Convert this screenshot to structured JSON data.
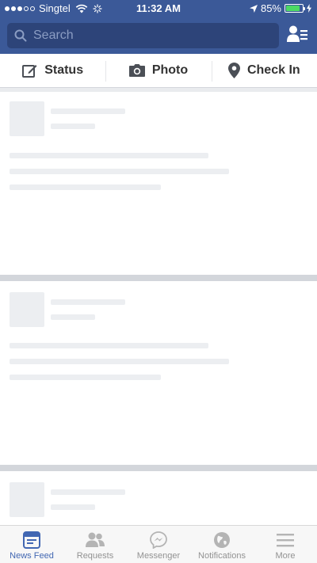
{
  "status_bar": {
    "carrier": "Singtel",
    "time": "11:32 AM",
    "battery": "85%",
    "battery_level": 0.85
  },
  "search": {
    "placeholder": "Search"
  },
  "composer": {
    "status": "Status",
    "photo": "Photo",
    "check_in": "Check In"
  },
  "tabs": [
    {
      "label": "News Feed",
      "active": true
    },
    {
      "label": "Requests"
    },
    {
      "label": "Messenger"
    },
    {
      "label": "Notifications"
    },
    {
      "label": "More"
    }
  ],
  "colors": {
    "brand": "#3b5998",
    "active_tab": "#4267b2",
    "battery": "#4cd964"
  }
}
